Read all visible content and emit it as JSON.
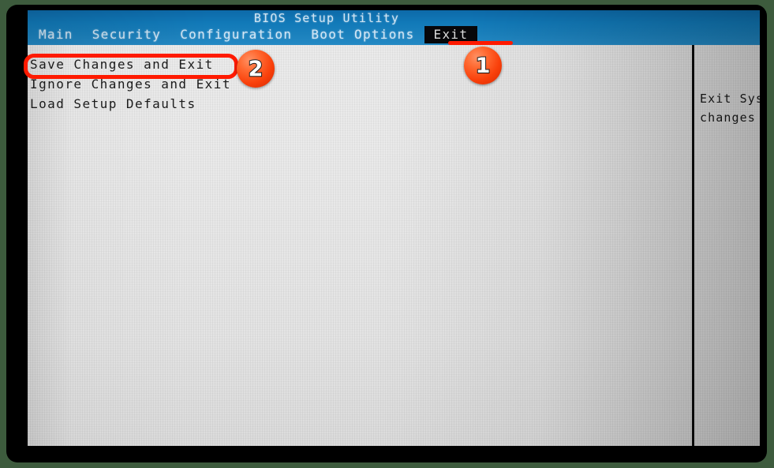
{
  "window": {
    "title": "BIOS Setup Utility"
  },
  "menubar": {
    "tabs": [
      {
        "label": "Main",
        "active": false
      },
      {
        "label": "Security",
        "active": false
      },
      {
        "label": "Configuration",
        "active": false
      },
      {
        "label": "Boot Options",
        "active": false
      },
      {
        "label": "Exit",
        "active": true
      }
    ]
  },
  "exit_menu": {
    "items": [
      {
        "label": "Save Changes and Exit",
        "selected": true
      },
      {
        "label": "Ignore Changes and Exit",
        "selected": false
      },
      {
        "label": "Load Setup Defaults",
        "selected": false
      }
    ]
  },
  "help_panel": {
    "lines": [
      "Exit Sys",
      "changes"
    ]
  },
  "annotations": {
    "badges": [
      {
        "number": "1",
        "target": "exit-tab"
      },
      {
        "number": "2",
        "target": "save-changes-and-exit-item"
      }
    ],
    "accent_color": "#ff1a00"
  },
  "colors": {
    "banner_blue": "#1179b8",
    "screen_gray": "#eaeaea",
    "selection_black": "#0a0a0c",
    "annotation_red": "#ff1a00",
    "badge_orange": "#f9400b",
    "outer_background": "#3d5b3d"
  }
}
